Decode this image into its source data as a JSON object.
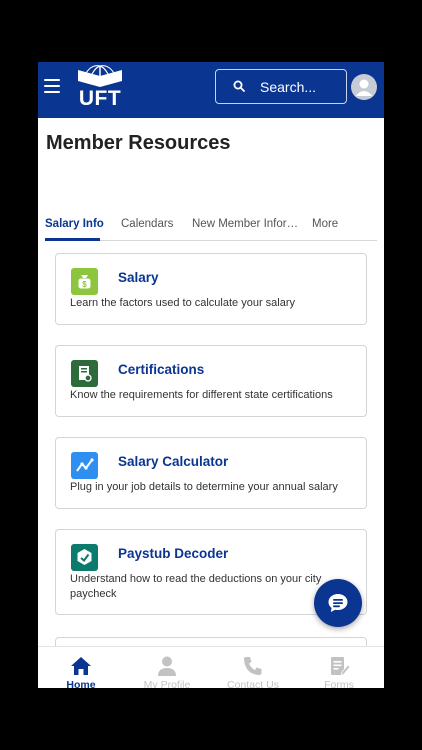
{
  "header": {
    "logo_text": "UFT",
    "search_placeholder": "Search..."
  },
  "page": {
    "title": "Member Resources"
  },
  "tabs": [
    {
      "label": "Salary Info",
      "active": true
    },
    {
      "label": "Calendars",
      "active": false
    },
    {
      "label": "New Member Infor…",
      "active": false
    },
    {
      "label": "More",
      "active": false
    }
  ],
  "cards": [
    {
      "title": "Salary",
      "description": "Learn the factors used to calculate your salary",
      "icon": "money-bag-icon",
      "icon_color": "#8cc63f"
    },
    {
      "title": "Certifications",
      "description": "Know the requirements for different state certifications",
      "icon": "certificate-icon",
      "icon_color": "#2e6b3a"
    },
    {
      "title": "Salary Calculator",
      "description": "Plug in your job details to determine your annual salary",
      "icon": "calculator-chart-icon",
      "icon_color": "#2e8ff0"
    },
    {
      "title": "Paystub Decoder",
      "description": "Understand how to read the deductions on your city paycheck",
      "icon": "paystub-icon",
      "icon_color": "#0d7a6e"
    }
  ],
  "bottom_nav": [
    {
      "label": "Home",
      "icon": "home-icon",
      "active": true
    },
    {
      "label": "My Profile",
      "icon": "user-icon",
      "active": false
    },
    {
      "label": "Contact Us",
      "icon": "phone-icon",
      "active": false
    },
    {
      "label": "Forms",
      "icon": "forms-icon",
      "active": false
    }
  ],
  "colors": {
    "brand": "#0a3591",
    "inactive": "#c2c2c2"
  }
}
